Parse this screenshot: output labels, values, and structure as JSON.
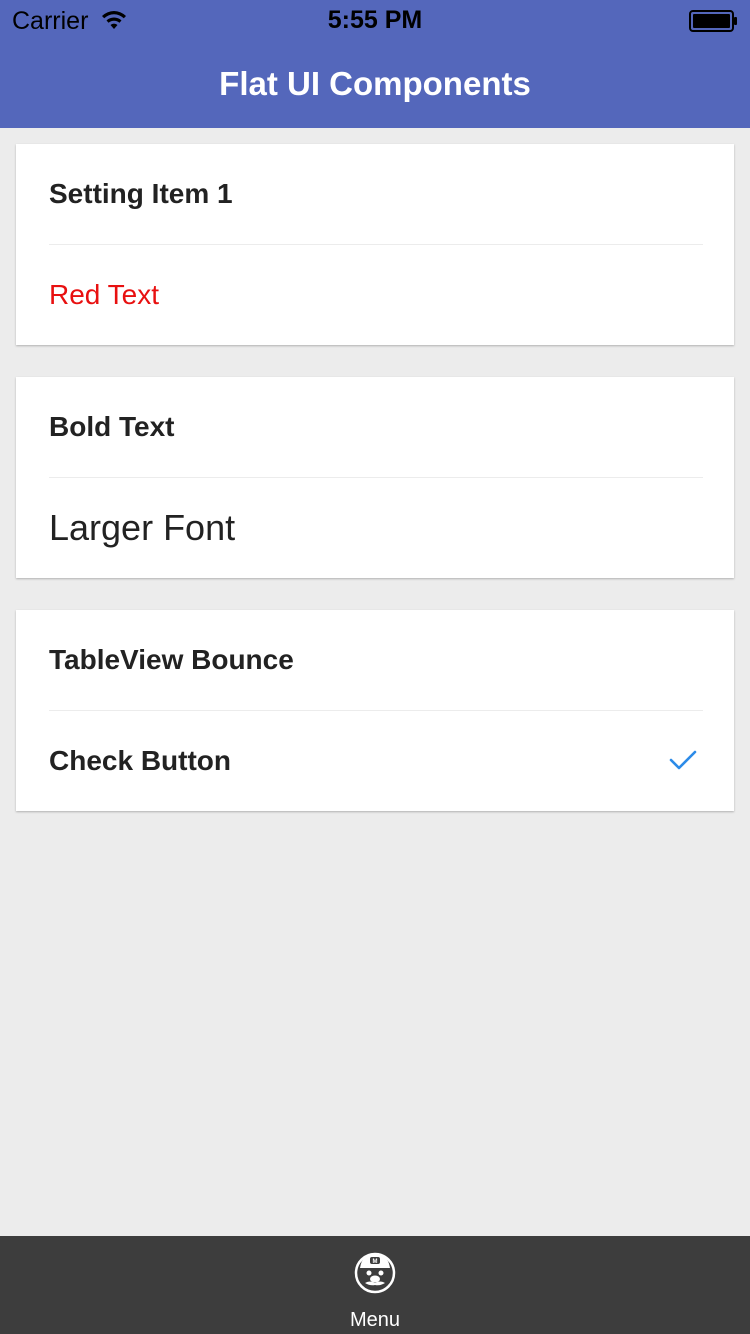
{
  "status_bar": {
    "carrier": "Carrier",
    "time": "5:55 PM",
    "wifi_icon": "wifi-icon",
    "battery_icon": "battery-full-icon"
  },
  "nav": {
    "title": "Flat UI Components",
    "background_color": "#5467bb"
  },
  "cards": [
    {
      "rows": [
        {
          "label": "Setting Item 1",
          "style": "bold"
        },
        {
          "label": "Red Text",
          "style": "red",
          "color": "#e81010"
        }
      ]
    },
    {
      "rows": [
        {
          "label": "Bold Text",
          "style": "bold"
        },
        {
          "label": "Larger Font",
          "style": "large"
        }
      ]
    },
    {
      "rows": [
        {
          "label": "TableView Bounce",
          "style": "bold"
        },
        {
          "label": "Check Button",
          "style": "bold",
          "accessory": "checkmark-icon",
          "checked": true,
          "accent_color": "#2c8be8"
        }
      ]
    }
  ],
  "tabbar": {
    "items": [
      {
        "label": "Menu",
        "icon": "mario-icon",
        "selected": true
      }
    ],
    "background_color": "#3d3d3d"
  }
}
